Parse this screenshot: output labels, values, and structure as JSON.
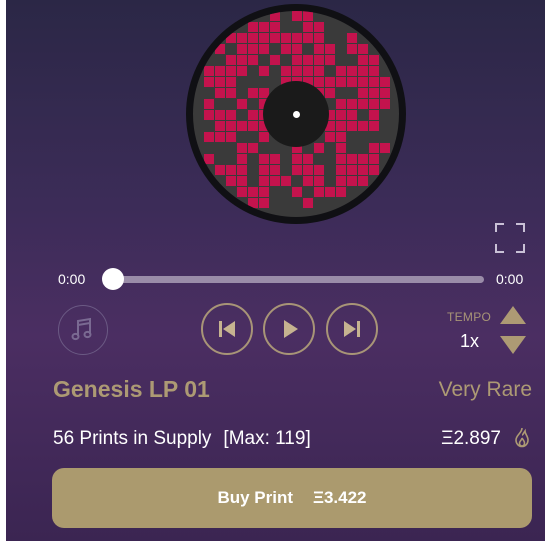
{
  "player": {
    "time_current": "0:00",
    "time_total": "0:00",
    "progress": 0
  },
  "icons": {
    "fullscreen": "fullscreen-icon",
    "music": "music-note-icon",
    "previous": "skip-previous-icon",
    "play": "play-icon",
    "next": "skip-next-icon",
    "tempo_up": "triangle-up-icon",
    "tempo_down": "triangle-down-icon",
    "flame": "flame-icon"
  },
  "tempo": {
    "label": "TEMPO",
    "value": "1x"
  },
  "item": {
    "title": "Genesis LP 01",
    "rarity": "Very Rare",
    "supply": "56 Prints in Supply",
    "max": "[Max: 119]",
    "price": "Ξ2.897"
  },
  "buy": {
    "label": "Buy Print",
    "price": "Ξ3.422"
  },
  "colors": {
    "accent_gold": "#ad9a74",
    "art_magenta": "#c4134d",
    "background_top": "#2b2746",
    "background_bottom": "#4b2e62"
  }
}
